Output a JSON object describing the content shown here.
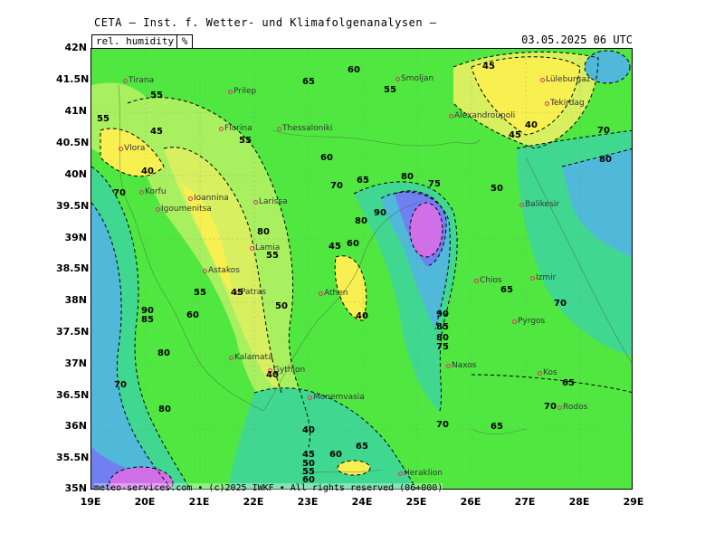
{
  "header": {
    "title": "CETA — Inst. f. Wetter- und Klimafolgenanalysen —",
    "parameter": "rel. humidity",
    "unit": "%",
    "valid_time": "03.05.2025 06 UTC"
  },
  "footer": {
    "credit": "meteo-services.com • (c)2025 IWKF • All rights reserved (06+000)"
  },
  "axes": {
    "lat_labels": [
      "42N",
      "41.5N",
      "41N",
      "40.5N",
      "40N",
      "39.5N",
      "39N",
      "38.5N",
      "38N",
      "37.5N",
      "37N",
      "36.5N",
      "36N",
      "35.5N",
      "35N"
    ],
    "lon_labels": [
      "19E",
      "20E",
      "21E",
      "22E",
      "23E",
      "24E",
      "25E",
      "26E",
      "27E",
      "28E",
      "29E"
    ]
  },
  "cities": [
    {
      "name": "Tirana"
    },
    {
      "name": "Prilep"
    },
    {
      "name": "Florina"
    },
    {
      "name": "Smoljan"
    },
    {
      "name": "Lüleburgaz"
    },
    {
      "name": "Tekirdag"
    },
    {
      "name": "Thessaloniki"
    },
    {
      "name": "Alexandroupoli"
    },
    {
      "name": "Vlora"
    },
    {
      "name": "Korfu"
    },
    {
      "name": "Ioannina"
    },
    {
      "name": "Igoumenitsa"
    },
    {
      "name": "Larissa"
    },
    {
      "name": "Balikesir"
    },
    {
      "name": "Lamia"
    },
    {
      "name": "Astakos"
    },
    {
      "name": "Chios"
    },
    {
      "name": "Patras"
    },
    {
      "name": "Athen"
    },
    {
      "name": "Izmir"
    },
    {
      "name": "Pyrgos"
    },
    {
      "name": "Naxos"
    },
    {
      "name": "Kalamata"
    },
    {
      "name": "Gythion"
    },
    {
      "name": "Monemvasia"
    },
    {
      "name": "Kos"
    },
    {
      "name": "Rodos"
    },
    {
      "name": "Heraklion"
    }
  ],
  "isolines": [
    "40",
    "45",
    "50",
    "55",
    "60",
    "65",
    "70",
    "75",
    "80",
    "85",
    "90"
  ],
  "colors": {
    "dry": "#f8f050",
    "low": "#d8f060",
    "mid_low": "#a8f060",
    "mid": "#50e840",
    "mid_high": "#40d890",
    "high": "#50b8d8",
    "very_high": "#7080f0",
    "peak": "#d070e8"
  }
}
